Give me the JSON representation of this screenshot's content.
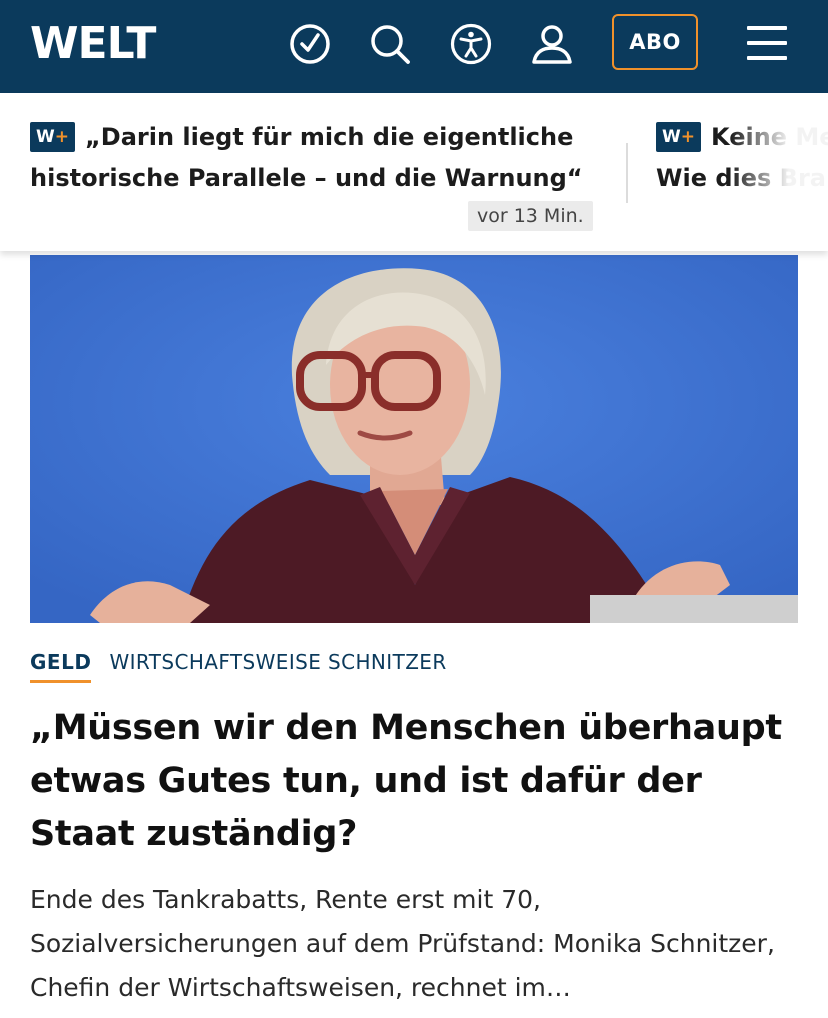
{
  "header": {
    "logo": "WELT",
    "abo_label": "ABO",
    "icons": [
      "clock-check-icon",
      "search-icon",
      "accessibility-icon",
      "user-icon",
      "menu-icon"
    ],
    "colors": {
      "brand": "#0b3a5c",
      "accent": "#f0912b"
    }
  },
  "ticker": {
    "items": [
      {
        "badge_w": "W",
        "badge_plus": "+",
        "text": "„Darin liegt für mich die eigentliche historische Parallele – und die Warnung“",
        "time": "vor 13 Min."
      },
      {
        "badge_w": "W",
        "badge_plus": "+",
        "text": "Keine Me ler – Wie dies Branche alar"
      }
    ]
  },
  "article": {
    "section": "GELD",
    "topic": "WIRTSCHAFTSWEISE SCHNITZER",
    "headline": "„Müssen wir den Menschen überhaupt etwas Gutes tun, und ist dafür der Staat zuständig?",
    "teaser": "Ende des Tankrabatts, Rente erst mit 70, Sozialversicherungen auf dem Prüfstand: Monika Schnitzer, Chefin der Wirtschaftsweisen, rechnet im…"
  }
}
